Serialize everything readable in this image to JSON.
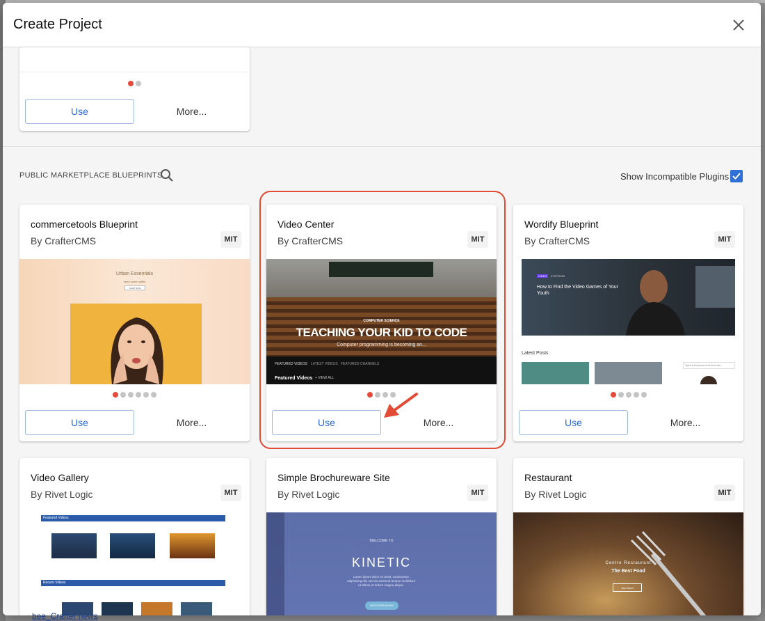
{
  "dialog": {
    "title": "Create Project"
  },
  "top_card": {
    "use_label": "Use",
    "more_label": "More..."
  },
  "marketplace": {
    "section_label": "PUBLIC MARKETPLACE BLUEPRINTS",
    "show_incompatible_label": "Show Incompatible Plugins",
    "show_incompatible_checked": true
  },
  "cards": [
    {
      "title": "commercetools Blueprint",
      "author": "By CrafterCMS",
      "license": "MIT",
      "use_label": "Use",
      "more_label": "More...",
      "preview": {
        "brand": "Urban Essentials",
        "tagline": "need some outfits",
        "cta": "SHOP NOW"
      }
    },
    {
      "title": "Video Center",
      "author": "By CrafterCMS",
      "license": "MIT",
      "use_label": "Use",
      "more_label": "More...",
      "preview": {
        "category": "COMPUTER SCIENCE",
        "headline": "TEACHING YOUR KID TO CODE",
        "sub": "Computer programming is becoming an...",
        "tabs": [
          "FEATURED VIDEOS",
          "LATEST VIDEOS",
          "FEATURED CHANNELS"
        ],
        "section": "Featured Videos",
        "view_all": "+ VIEW ALL"
      }
    },
    {
      "title": "Wordify Blueprint",
      "author": "By CrafterCMS",
      "license": "MIT",
      "use_label": "Use",
      "more_label": "More...",
      "preview": {
        "tag": "VIDEO",
        "date": "07/07/2019",
        "headline": "How to Find the Video Games of Your Youth",
        "latest": "Latest Posts",
        "search_placeholder": "Type a keyword and hit enter"
      }
    },
    {
      "title": "Video Gallery",
      "author": "By Rivet Logic",
      "license": "MIT",
      "preview": {
        "featured": "Featured Videos",
        "recent": "Recent Videos"
      }
    },
    {
      "title": "Simple Brochureware Site",
      "author": "By Rivet Logic",
      "license": "MIT",
      "preview": {
        "welcome": "WELCOME TO",
        "brand": "KINETIC",
        "body": "Lorem ipsum dolor sit amet, consectetur adipisicing elit, sed do eiusmod tempor incididunt ut labore et dolore magna aliqua.",
        "cta": "DISCOVER MORE"
      }
    },
    {
      "title": "Restaurant",
      "author": "By Rivet Logic",
      "license": "MIT",
      "preview": {
        "kicker": "Centre Restaurant",
        "headline": "The Best Food",
        "cta": "See More"
      }
    }
  ],
  "background": {
    "link_text": "bee_Crafter news"
  },
  "colors": {
    "accent": "#2a6ad3",
    "dot_active": "#e64a3b",
    "highlight": "#e24b35",
    "checkbox": "#2e6fd8"
  }
}
